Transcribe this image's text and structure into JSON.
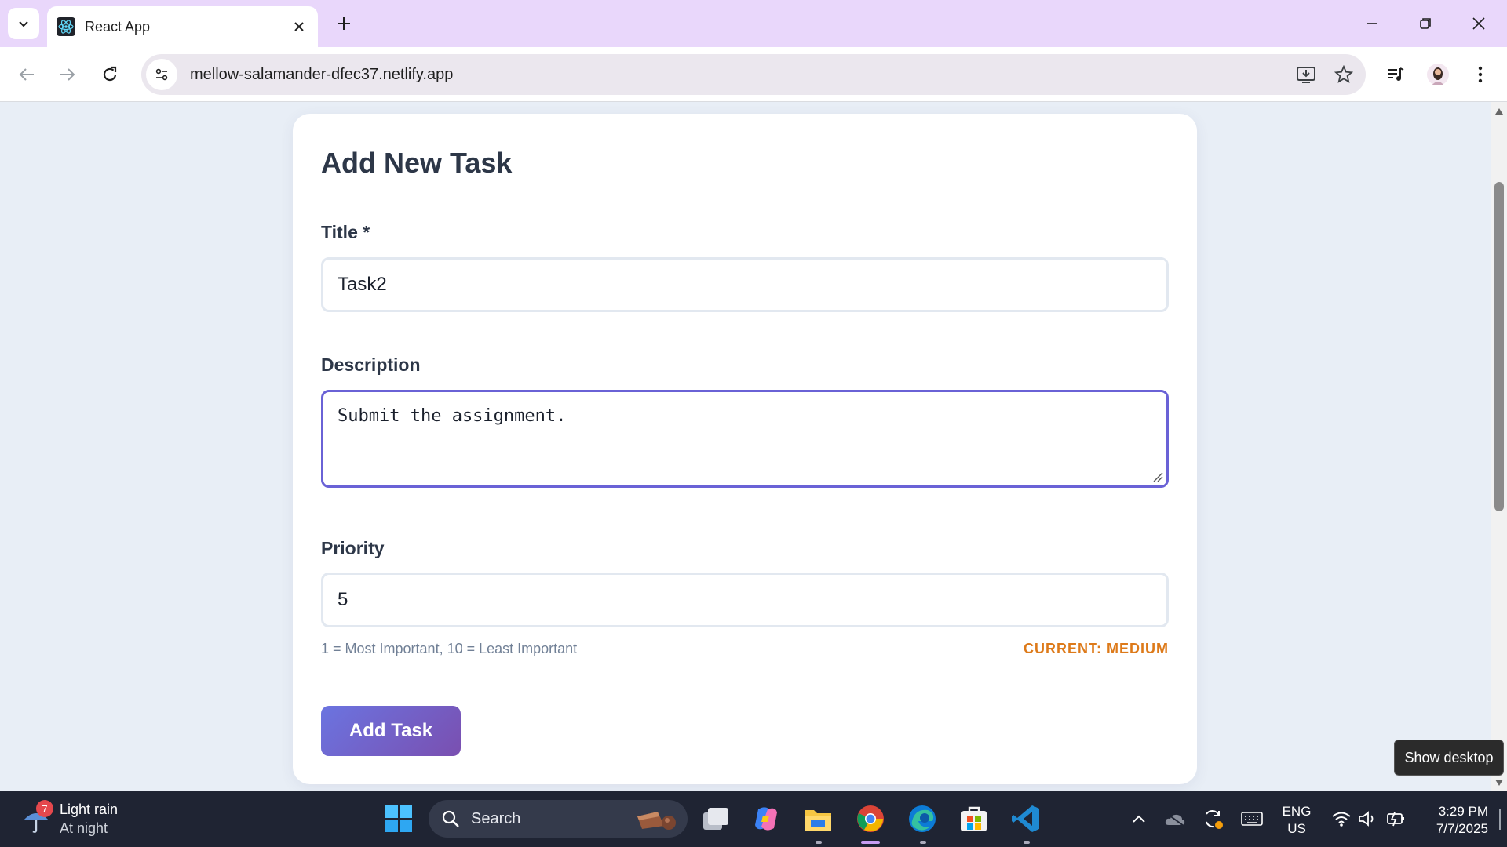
{
  "browser": {
    "tab_title": "React App",
    "url": "mellow-salamander-dfec37.netlify.app"
  },
  "form": {
    "heading": "Add New Task",
    "title_label": "Title *",
    "title_value": "Task2",
    "description_label": "Description",
    "description_value": "Submit the assignment.",
    "priority_label": "Priority",
    "priority_value": "5",
    "priority_hint": "1 = Most Important, 10 = Least Important",
    "priority_current": "CURRENT: MEDIUM",
    "submit_label": "Add Task"
  },
  "tooltip": "Show desktop",
  "taskbar": {
    "weather_badge": "7",
    "weather_line1": "Light rain",
    "weather_line2": "At night",
    "search_label": "Search",
    "lang_line1": "ENG",
    "lang_line2": "US",
    "time": "3:29 PM",
    "date": "7/7/2025"
  },
  "colors": {
    "tab_strip": "#e9d7fb",
    "page_background": "#e8eef6",
    "focus_border": "#6a62d6",
    "priority_current": "#dd7a1a",
    "button_gradient_start": "#6b74e0",
    "button_gradient_end": "#7a4fb0",
    "taskbar": "#1f2433"
  },
  "icons": [
    "tab-search-icon",
    "react-favicon-icon",
    "close-icon",
    "plus-icon",
    "minimize-icon",
    "restore-icon",
    "back-icon",
    "forward-icon",
    "reload-icon",
    "site-info-icon",
    "install-icon",
    "bookmark-star-icon",
    "media-icon",
    "profile-avatar-icon",
    "menu-icon",
    "windows-start-icon",
    "search-icon",
    "task-view-icon",
    "copilot-icon",
    "file-explorer-icon",
    "chrome-icon",
    "edge-icon",
    "store-icon",
    "vscode-icon",
    "chevron-up-icon",
    "onedrive-icon",
    "sync-icon",
    "keyboard-icon",
    "wifi-icon",
    "volume-icon",
    "battery-icon"
  ]
}
